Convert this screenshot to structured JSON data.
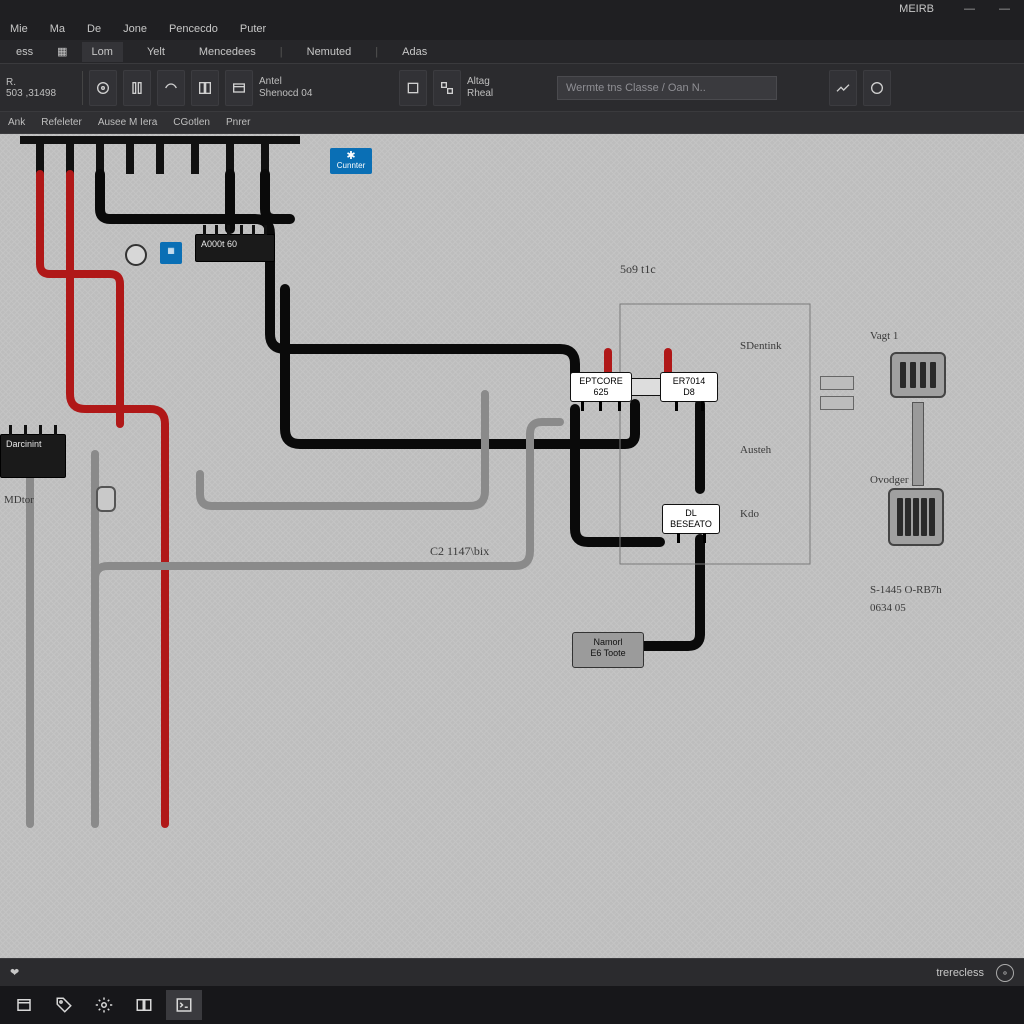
{
  "title": "MEIRB",
  "menu": [
    "Mie",
    "Ma",
    "De",
    "Jone",
    "Pencecdo",
    "Puter"
  ],
  "tabs": {
    "prefix": "ess",
    "items": [
      "Lom",
      "Yelt",
      "Mencedees",
      "Nemuted",
      "Adas"
    ]
  },
  "toolbar": {
    "readout_top": "R.",
    "readout_bottom": "503 ,31498",
    "btn1_label": "Antel\nShenocd 04",
    "btn2_label": "Altag\nRheal",
    "search_placeholder": "Wermte tns Classe / Oan N.."
  },
  "subtoolbar": [
    "Ank",
    "Refeleter",
    "Ausee M Iera",
    "CGotlen",
    "Pnrer"
  ],
  "canvas": {
    "blue_badge": "Cunnter",
    "chip1": "A000t 60",
    "chip_left_top": "Darcinint",
    "chip_left_bottom": "MDtor",
    "connector_box1": "EPTCORE\n625",
    "connector_box2": "ER7014\nD8",
    "connector_box3": "DL\nBESEATO",
    "module_box": "Namorl\nE6 Toote",
    "center_label": "C2  1147\\bix",
    "right_lbl1": "5o9  t1c",
    "right_lbl2": "SDentink",
    "right_lbl3": "Austeh",
    "right_lbl4": "Kdo",
    "side_lbl1": "Vagt 1",
    "side_lbl2": "Ovodger",
    "side_code1": "S-1445 O-RB7h",
    "side_code2": "0634  05"
  },
  "statusbar": {
    "heart": "❤",
    "right_text": "trerecless"
  },
  "taskbar_icons": [
    "window",
    "tag",
    "gear",
    "panel",
    "terminal"
  ]
}
